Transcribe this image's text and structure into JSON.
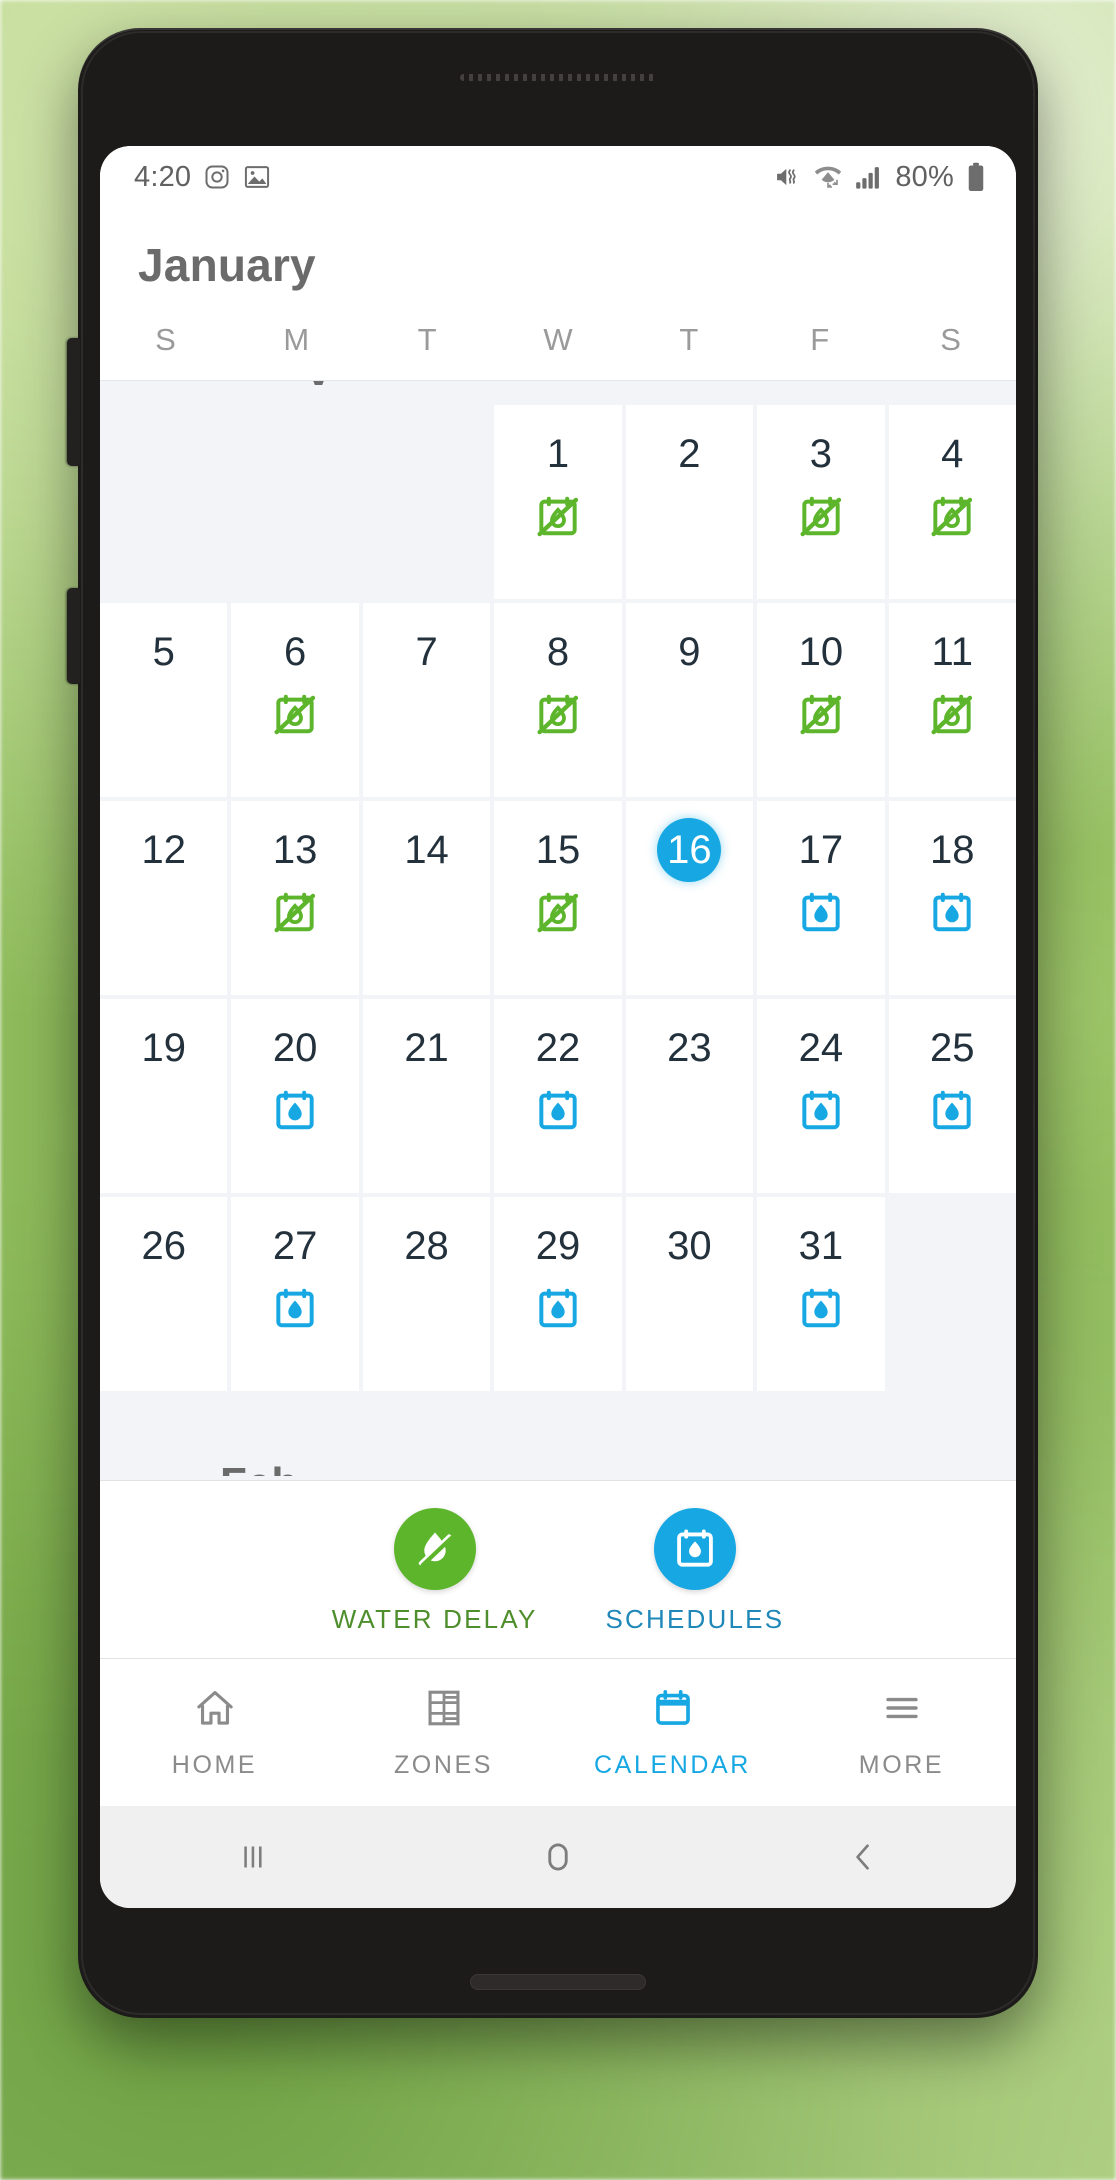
{
  "statusbar": {
    "time": "4:20",
    "battery_percent": "80%",
    "left_icons": [
      "instagram-icon",
      "gallery-icon"
    ],
    "right_icons": [
      "mute-vibrate-icon",
      "wifi-icon",
      "signal-bars-icon",
      "battery-icon"
    ]
  },
  "header": {
    "month_title": "January",
    "prev_month_peek": "y",
    "next_month_peek": "Feb"
  },
  "weekdays": [
    "S",
    "M",
    "T",
    "W",
    "T",
    "F",
    "S"
  ],
  "calendar": {
    "today": 16,
    "weeks": [
      [
        {
          "day": "",
          "badge": "none"
        },
        {
          "day": "",
          "badge": "none"
        },
        {
          "day": "",
          "badge": "none"
        },
        {
          "day": "1",
          "badge": "water-delay"
        },
        {
          "day": "2",
          "badge": "none"
        },
        {
          "day": "3",
          "badge": "water-delay"
        },
        {
          "day": "4",
          "badge": "water-delay"
        }
      ],
      [
        {
          "day": "5",
          "badge": "none"
        },
        {
          "day": "6",
          "badge": "water-delay"
        },
        {
          "day": "7",
          "badge": "none"
        },
        {
          "day": "8",
          "badge": "water-delay"
        },
        {
          "day": "9",
          "badge": "none"
        },
        {
          "day": "10",
          "badge": "water-delay"
        },
        {
          "day": "11",
          "badge": "water-delay"
        }
      ],
      [
        {
          "day": "12",
          "badge": "none"
        },
        {
          "day": "13",
          "badge": "water-delay"
        },
        {
          "day": "14",
          "badge": "none"
        },
        {
          "day": "15",
          "badge": "water-delay"
        },
        {
          "day": "16",
          "badge": "none",
          "today": true
        },
        {
          "day": "17",
          "badge": "schedule"
        },
        {
          "day": "18",
          "badge": "schedule"
        }
      ],
      [
        {
          "day": "19",
          "badge": "none"
        },
        {
          "day": "20",
          "badge": "schedule"
        },
        {
          "day": "21",
          "badge": "none"
        },
        {
          "day": "22",
          "badge": "schedule"
        },
        {
          "day": "23",
          "badge": "none"
        },
        {
          "day": "24",
          "badge": "schedule"
        },
        {
          "day": "25",
          "badge": "schedule"
        }
      ],
      [
        {
          "day": "26",
          "badge": "none"
        },
        {
          "day": "27",
          "badge": "schedule"
        },
        {
          "day": "28",
          "badge": "none"
        },
        {
          "day": "29",
          "badge": "schedule"
        },
        {
          "day": "30",
          "badge": "none"
        },
        {
          "day": "31",
          "badge": "schedule"
        },
        {
          "day": "",
          "badge": "none"
        }
      ]
    ]
  },
  "legend": [
    {
      "label": "WATER DELAY",
      "icon": "water-delay-icon",
      "color": "#5cb52b"
    },
    {
      "label": "SCHEDULES",
      "icon": "schedules-icon",
      "color": "#17a8e3"
    }
  ],
  "bottom_nav": [
    {
      "label": "HOME",
      "icon": "home-icon",
      "active": false
    },
    {
      "label": "ZONES",
      "icon": "zones-grid-icon",
      "active": false
    },
    {
      "label": "CALENDAR",
      "icon": "calendar-icon",
      "active": true
    },
    {
      "label": "MORE",
      "icon": "hamburger-menu-icon",
      "active": false
    }
  ],
  "system_nav": [
    {
      "icon": "recents-icon"
    },
    {
      "icon": "home-circle-icon"
    },
    {
      "icon": "back-chevron-icon"
    }
  ],
  "colors": {
    "accent_blue": "#17a8e3",
    "accent_green": "#5cb52b",
    "day_text": "#23313c",
    "muted_text": "#9a9a9a"
  }
}
